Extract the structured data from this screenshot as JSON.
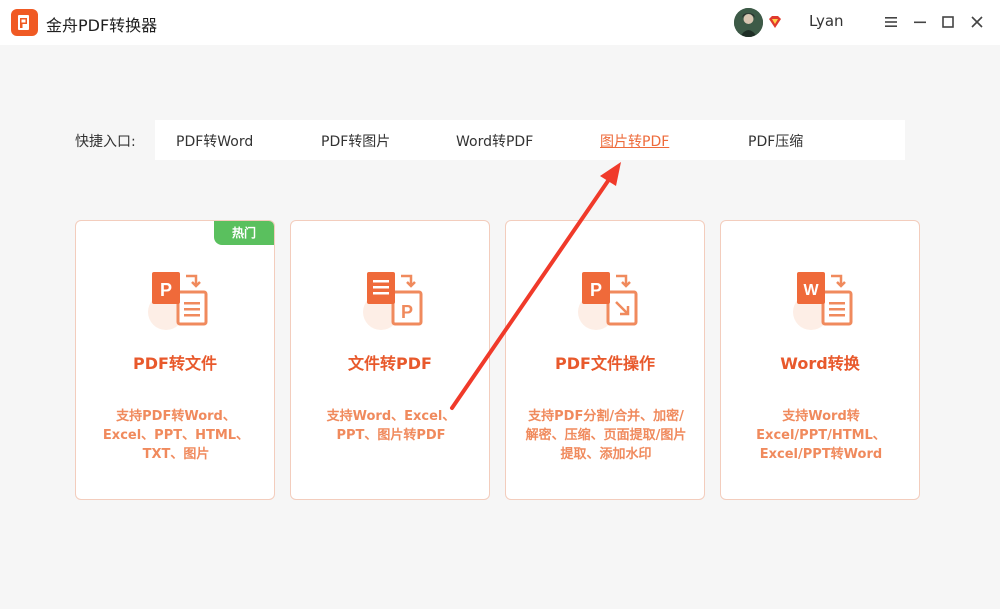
{
  "app": {
    "title": "金舟PDF转换器",
    "username": "Lyan"
  },
  "colors": {
    "accent": "#ee6b3b",
    "title_orange": "#e8592c",
    "desc_orange": "#f08a5d",
    "hot_green": "#5ac05e"
  },
  "window_controls": [
    "menu-icon",
    "minimize-icon",
    "maximize-icon",
    "close-icon"
  ],
  "quick_entry": {
    "label": "快捷入口:",
    "links": [
      {
        "label": "PDF转Word",
        "active": false
      },
      {
        "label": "PDF转图片",
        "active": false
      },
      {
        "label": "Word转PDF",
        "active": false
      },
      {
        "label": "图片转PDF",
        "active": true
      },
      {
        "label": "PDF压缩",
        "active": false
      }
    ]
  },
  "cards": [
    {
      "title": "PDF转文件",
      "desc": "支持PDF转Word、Excel、PPT、HTML、TXT、图片",
      "badge": "热门",
      "icon": "pdf-to-file-icon"
    },
    {
      "title": "文件转PDF",
      "desc": "支持Word、Excel、PPT、图片转PDF",
      "icon": "file-to-pdf-icon"
    },
    {
      "title": "PDF文件操作",
      "desc": "支持PDF分割/合并、加密/解密、压缩、页面提取/图片提取、添加水印",
      "icon": "pdf-operations-icon"
    },
    {
      "title": "Word转换",
      "desc": "支持Word转Excel/PPT/HTML、Excel/PPT转Word",
      "icon": "word-convert-icon"
    }
  ]
}
